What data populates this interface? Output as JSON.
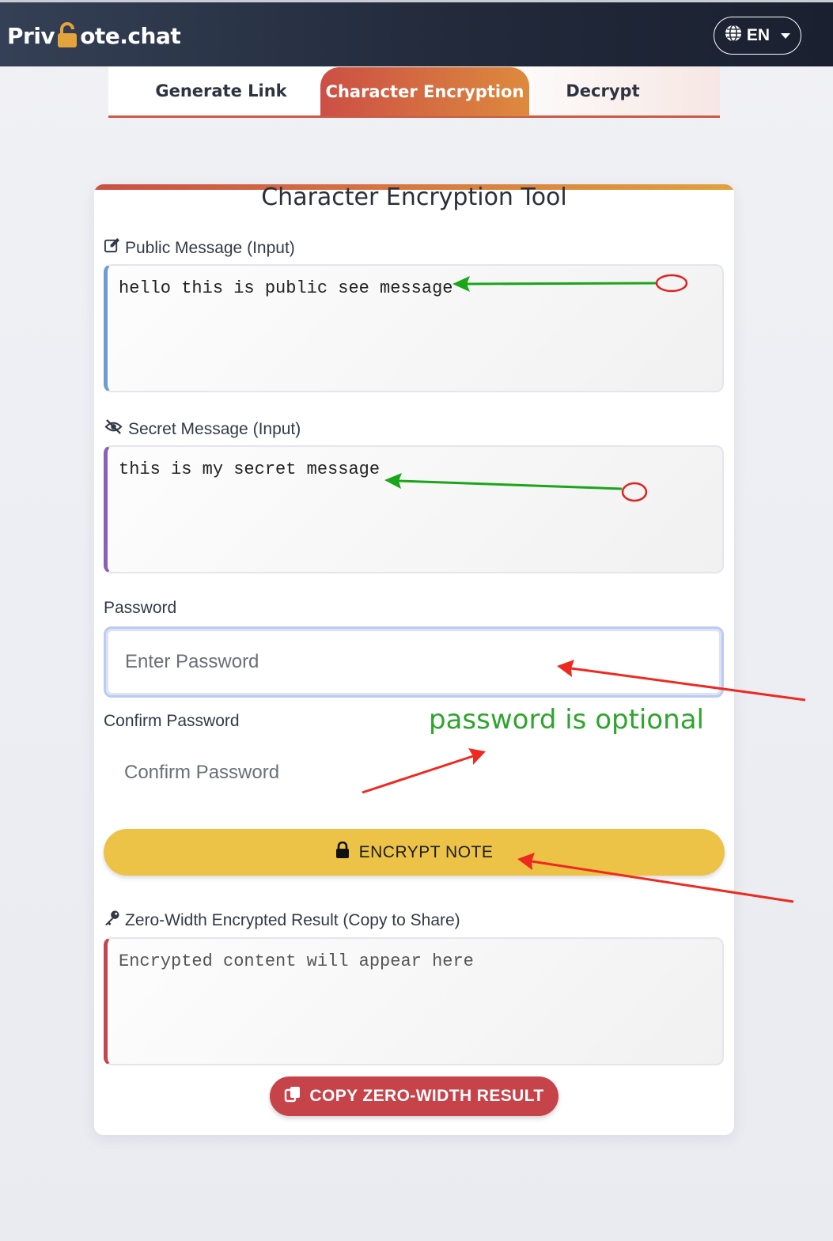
{
  "navbar": {
    "brand_before": "Priv",
    "brand_after": "ote.chat",
    "lang_label": "EN"
  },
  "tabs": [
    {
      "label": "Generate Link",
      "active": false
    },
    {
      "label": "Character Encryption",
      "active": true
    },
    {
      "label": "Decrypt",
      "active": false
    }
  ],
  "tool": {
    "title": "Character Encryption Tool",
    "public_label": "Public Message (Input)",
    "public_value": "hello this is public see message",
    "secret_label": "Secret Message (Input)",
    "secret_value": "this is my secret message",
    "password_label": "Password",
    "password_placeholder": "Enter Password",
    "confirm_label": "Confirm Password",
    "confirm_placeholder": "Confirm Password",
    "encrypt_button": "ENCRYPT NOTE",
    "result_label": "Zero-Width Encrypted Result (Copy to Share)",
    "result_placeholder": "Encrypted content will appear here",
    "copy_button": "COPY ZERO-WIDTH RESULT"
  },
  "annotations": {
    "note": "password is optional",
    "arrow_green": "#1aa51a",
    "arrow_red": "#ee2a20"
  },
  "colors": {
    "accent_start": "#cc4f45",
    "accent_end": "#e1a13d",
    "encrypt_button": "#ecc247",
    "copy_button": "#c6434a"
  }
}
